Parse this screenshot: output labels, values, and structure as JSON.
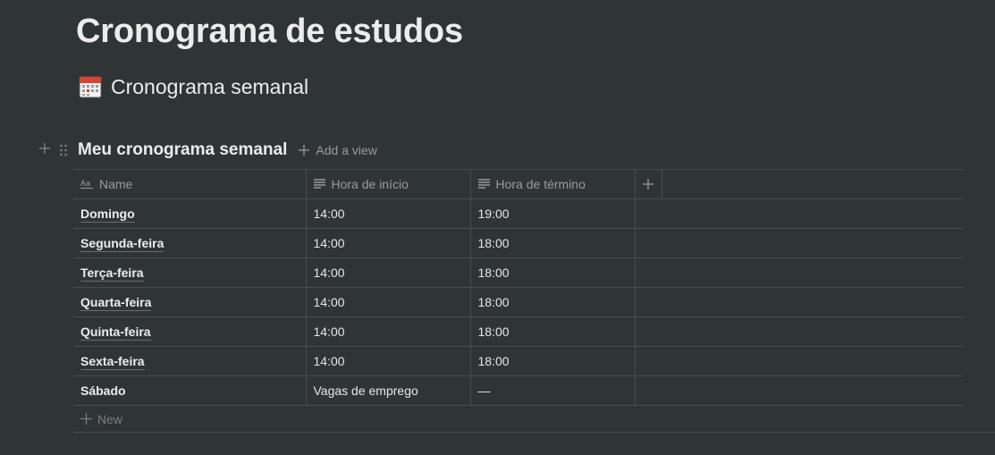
{
  "page": {
    "title": "Cronograma de estudos",
    "subtitle": "Cronograma semanal",
    "subtitle_icon": "calendar-icon"
  },
  "database": {
    "title": "Meu cronograma semanal",
    "add_view_label": "Add a view",
    "columns": [
      {
        "label": "Name",
        "icon": "title-property-icon"
      },
      {
        "label": "Hora de início",
        "icon": "text-property-icon"
      },
      {
        "label": "Hora de término",
        "icon": "text-property-icon"
      }
    ],
    "rows": [
      {
        "name": "Domingo",
        "start": "14:00",
        "end": "19:00"
      },
      {
        "name": "Segunda-feira",
        "start": "14:00",
        "end": "18:00"
      },
      {
        "name": "Terça-feira",
        "start": "14:00",
        "end": "18:00"
      },
      {
        "name": "Quarta-feira",
        "start": "14:00",
        "end": "18:00"
      },
      {
        "name": "Quinta-feira",
        "start": "14:00",
        "end": "18:00"
      },
      {
        "name": "Sexta-feira",
        "start": "14:00",
        "end": "18:00"
      },
      {
        "name": "Sábado",
        "start": "Vagas de emprego",
        "end": "—"
      }
    ],
    "new_label": "New"
  },
  "colors": {
    "background": "#2f3437",
    "text": "#ececec",
    "muted": "#9b9b9b",
    "border": "#474c50"
  }
}
